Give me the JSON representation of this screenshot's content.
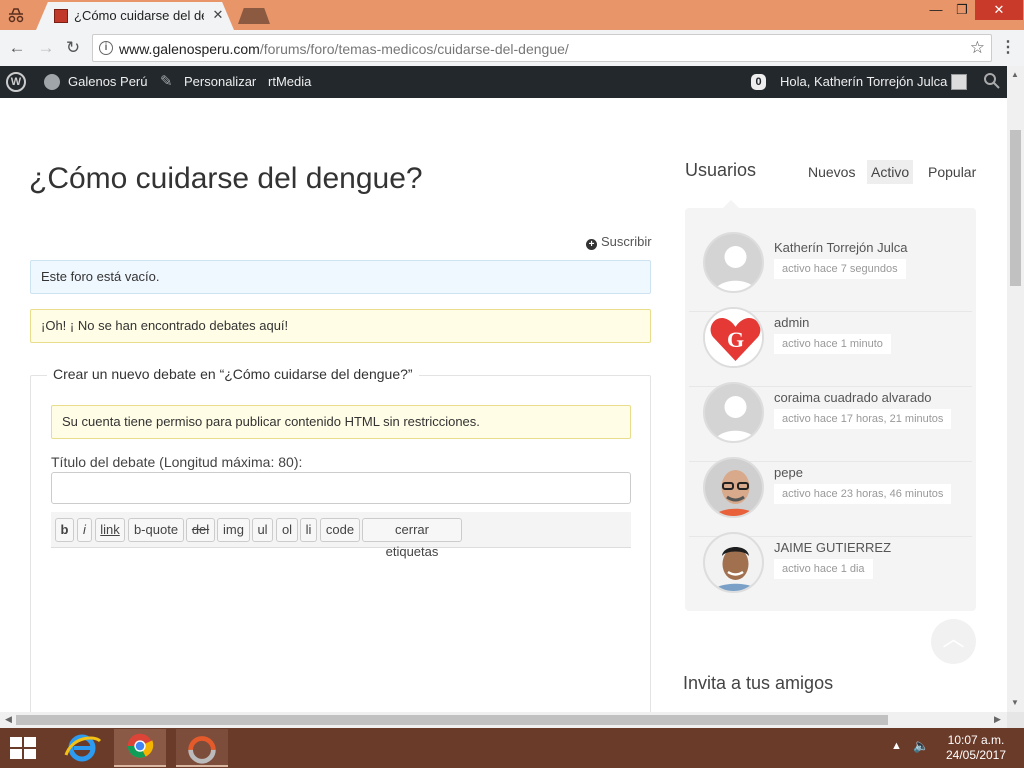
{
  "browser": {
    "tab_title": "¿Cómo cuidarse del dengue?",
    "tab_close": "✕",
    "url_host": "www.galenosperu.com",
    "url_path": "/forums/foro/temas-medicos/cuidarse-del-dengue/",
    "window_min": "—",
    "window_max": "❐",
    "window_close": "✕"
  },
  "adminbar": {
    "site_name": "Galenos Perú",
    "customize": "Personalizar",
    "rtmedia": "rtMedia",
    "notifications": "0",
    "greeting": "Hola, Katherín Torrejón Julca"
  },
  "main": {
    "title": "¿Cómo cuidarse del dengue?",
    "subscribe": "Suscribir",
    "notice_empty": "Este foro está vacío.",
    "notice_none": "¡Oh! ¡ No se han encontrado debates aquí!",
    "form": {
      "legend": "Crear un nuevo debate en “¿Cómo cuidarse del dengue?”",
      "permission": "Su cuenta tiene permiso para publicar contenido HTML sin restricciones.",
      "title_label": "Título del debate (Longitud máxima: 80):",
      "title_value": "",
      "toolbar": [
        "b",
        "i",
        "link",
        "b-quote",
        "del",
        "img",
        "ul",
        "ol",
        "li",
        "code",
        "cerrar etiquetas"
      ]
    }
  },
  "sidebar": {
    "title": "Usuarios",
    "filters": [
      "Nuevos",
      "Activo",
      "Popular"
    ],
    "active_filter": "Activo",
    "users": [
      {
        "name": "Katherín Torrejón Julca",
        "activity": "activo hace 7 segundos"
      },
      {
        "name": "admin",
        "activity": "activo hace 1 minuto"
      },
      {
        "name": "coraima cuadrado alvarado",
        "activity": "activo hace 17 horas, 21 minutos"
      },
      {
        "name": "pepe",
        "activity": "activo hace 23 horas, 46 minutos"
      },
      {
        "name": "JAIME GUTIERREZ",
        "activity": "activo hace 1 dia"
      }
    ],
    "invite_title": "Invita a tus amigos"
  },
  "taskbar": {
    "time": "10:07 a.m.",
    "date": "24/05/2017"
  },
  "colors": {
    "tab_strip": "#e8956a",
    "admin_bar": "#23282d",
    "taskbar": "#6b3b2a",
    "info_notice": "#f0f8ff",
    "warning_notice": "#fffde5"
  }
}
